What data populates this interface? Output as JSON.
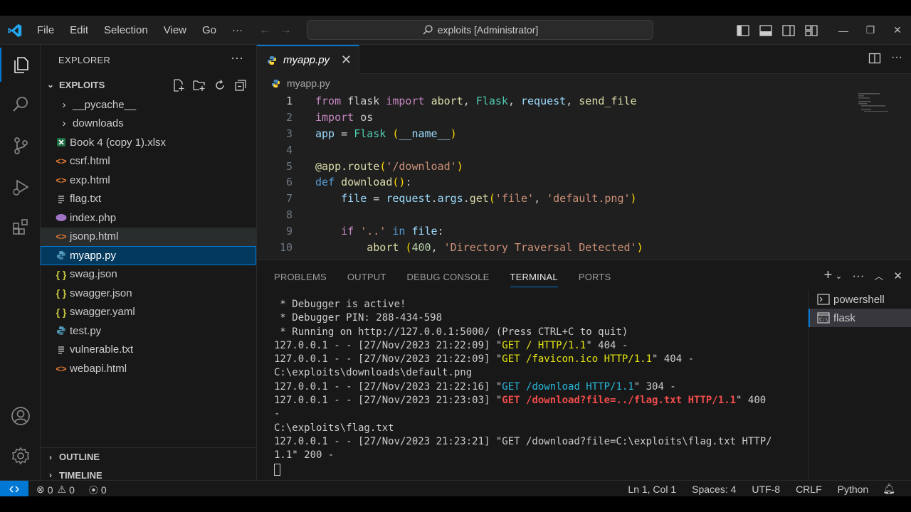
{
  "titlebar": {
    "menu": [
      "File",
      "Edit",
      "Selection",
      "View",
      "Go",
      "···"
    ],
    "search": "exploits [Administrator]"
  },
  "sidebar": {
    "title": "EXPLORER",
    "folder": "EXPLOITS",
    "items": [
      {
        "label": "__pycache__",
        "icon": "chevron-right-icon",
        "type": "folder"
      },
      {
        "label": "downloads",
        "icon": "chevron-right-icon",
        "type": "folder"
      },
      {
        "label": "Book 4 (copy 1).xlsx",
        "icon": "excel-icon",
        "type": "file"
      },
      {
        "label": "csrf.html",
        "icon": "html-icon",
        "type": "file"
      },
      {
        "label": "exp.html",
        "icon": "html-icon",
        "type": "file"
      },
      {
        "label": "flag.txt",
        "icon": "text-icon",
        "type": "file"
      },
      {
        "label": "index.php",
        "icon": "php-icon",
        "type": "file"
      },
      {
        "label": "jsonp.html",
        "icon": "html-icon",
        "type": "file"
      },
      {
        "label": "myapp.py",
        "icon": "python-icon",
        "type": "file"
      },
      {
        "label": "swag.json",
        "icon": "json-icon",
        "type": "file"
      },
      {
        "label": "swagger.json",
        "icon": "json-icon",
        "type": "file"
      },
      {
        "label": "swagger.yaml",
        "icon": "yaml-icon",
        "type": "file"
      },
      {
        "label": "test.py",
        "icon": "python-icon",
        "type": "file"
      },
      {
        "label": "vulnerable.txt",
        "icon": "text-icon",
        "type": "file"
      },
      {
        "label": "webapi.html",
        "icon": "html-icon",
        "type": "file"
      }
    ],
    "outline": "OUTLINE",
    "timeline": "TIMELINE"
  },
  "editor": {
    "tab_label": "myapp.py",
    "breadcrumb": "myapp.py",
    "line_numbers": [
      "1",
      "2",
      "3",
      "4",
      "5",
      "6",
      "7",
      "8",
      "9",
      "10"
    ]
  },
  "panel": {
    "tabs": [
      "PROBLEMS",
      "OUTPUT",
      "DEBUG CONSOLE",
      "TERMINAL",
      "PORTS"
    ],
    "active_tab": "TERMINAL",
    "terminals": [
      "powershell",
      "flask"
    ],
    "lines": [
      [
        {
          "t": " * Debugger is active!"
        }
      ],
      [
        {
          "t": " * Debugger PIN: 288-434-598"
        }
      ],
      [
        {
          "t": " * Running on http://127.0.0.1:5000/ (Press CTRL+C to quit)"
        }
      ],
      [
        {
          "t": "127.0.0.1 - - [27/Nov/2023 21:22:09] \""
        },
        {
          "t": "GET / HTTP/1.1",
          "c": "t-yel"
        },
        {
          "t": "\" 404 -"
        }
      ],
      [
        {
          "t": "127.0.0.1 - - [27/Nov/2023 21:22:09] \""
        },
        {
          "t": "GET /favicon.ico HTTP/1.1",
          "c": "t-yel"
        },
        {
          "t": "\" 404 -"
        }
      ],
      [
        {
          "t": "C:\\exploits\\downloads\\default.png"
        }
      ],
      [
        {
          "t": "127.0.0.1 - - [27/Nov/2023 21:22:16] \""
        },
        {
          "t": "GET /download HTTP/1.1",
          "c": "t-cyan"
        },
        {
          "t": "\" 304 -"
        }
      ],
      [
        {
          "t": "127.0.0.1 - - [27/Nov/2023 21:23:03] \""
        },
        {
          "t": "GET /download?file=../flag.txt HTTP/1.1",
          "c": "t-red"
        },
        {
          "t": "\" 400"
        }
      ],
      [
        {
          "t": "-"
        }
      ],
      [
        {
          "t": "C:\\exploits\\flag.txt"
        }
      ],
      [
        {
          "t": "127.0.0.1 - - [27/Nov/2023 21:23:21] \"GET /download?file=C:\\exploits\\flag.txt HTTP/"
        }
      ],
      [
        {
          "t": "1.1\" 200 -"
        }
      ]
    ]
  },
  "statusbar": {
    "errors": "0",
    "warnings": "0",
    "ports": "0",
    "position": "Ln 1, Col 1",
    "spaces": "Spaces: 4",
    "encoding": "UTF-8",
    "eol": "CRLF",
    "language": "Python"
  },
  "colors": {
    "accent": "#0078d4",
    "selection": "#04395e",
    "background": "#1f1f1f"
  }
}
